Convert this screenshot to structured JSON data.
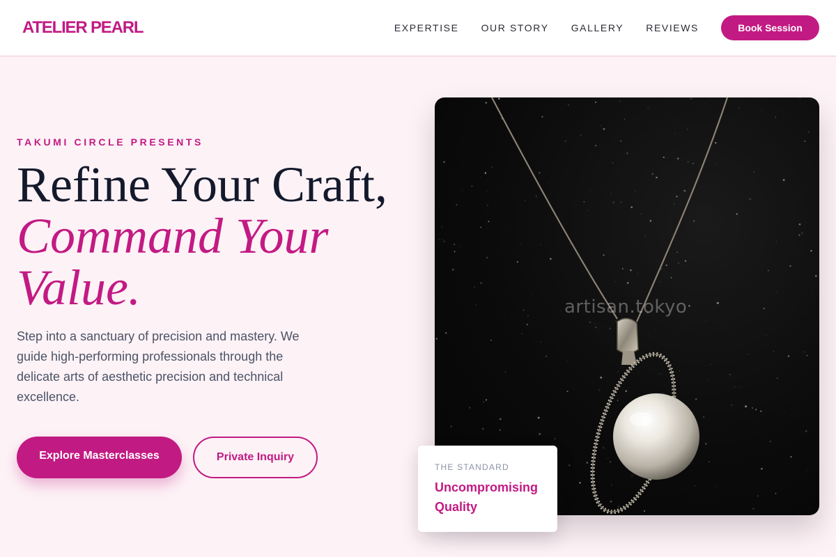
{
  "header": {
    "logo": "ATELIER PEARL",
    "nav": [
      {
        "label": "EXPERTISE"
      },
      {
        "label": "OUR STORY"
      },
      {
        "label": "GALLERY"
      },
      {
        "label": "REVIEWS"
      }
    ],
    "cta_label": "Book Session"
  },
  "hero": {
    "eyebrow": "TAKUMI CIRCLE PRESENTS",
    "title_line1": "Refine Your Craft,",
    "title_accent": "Command Your Value.",
    "description": "Step into a sanctuary of precision and mastery. We guide high-performing professionals through the delicate arts of aesthetic precision and technical excellence.",
    "primary_button": "Explore Masterclasses",
    "secondary_button": "Private Inquiry",
    "image_watermark": "artisan.tokyo"
  },
  "card": {
    "label": "THE STANDARD",
    "title": "Uncompromising Quality"
  },
  "colors": {
    "accent": "#c21a83",
    "background": "#fdf2f6",
    "heading": "#141a2c"
  }
}
